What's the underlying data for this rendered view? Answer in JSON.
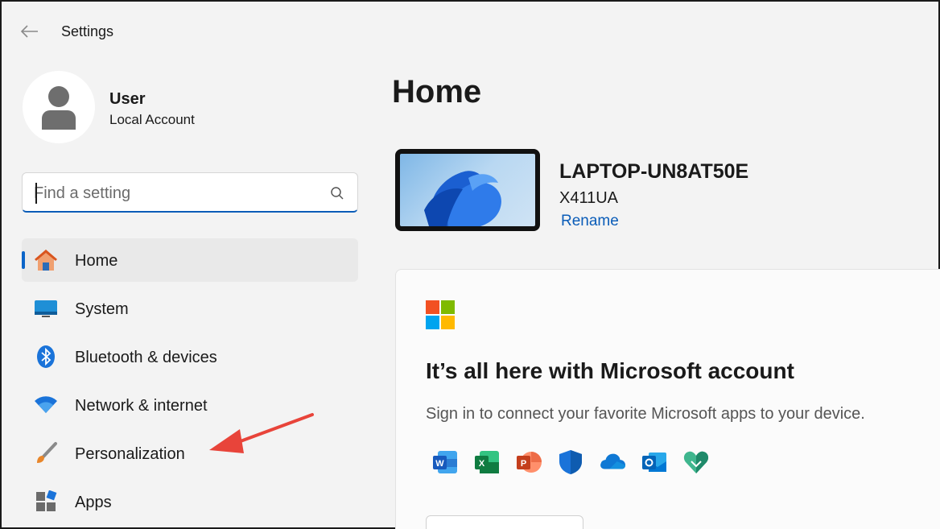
{
  "window": {
    "title": "Settings"
  },
  "profile": {
    "name": "User",
    "account_type": "Local Account"
  },
  "search": {
    "placeholder": "Find a setting",
    "value": ""
  },
  "sidebar": {
    "items": [
      {
        "label": "Home",
        "icon": "home-icon",
        "active": true
      },
      {
        "label": "System",
        "icon": "system-icon"
      },
      {
        "label": "Bluetooth & devices",
        "icon": "bluetooth-icon"
      },
      {
        "label": "Network & internet",
        "icon": "wifi-icon"
      },
      {
        "label": "Personalization",
        "icon": "paintbrush-icon"
      },
      {
        "label": "Apps",
        "icon": "apps-icon"
      }
    ]
  },
  "main": {
    "title": "Home",
    "device": {
      "name": "LAPTOP-UN8AT50E",
      "model": "X411UA",
      "rename_label": "Rename"
    },
    "promo": {
      "title": "It’s all here with Microsoft account",
      "description": "Sign in to connect your favorite Microsoft apps to your device.",
      "apps": [
        "word-icon",
        "excel-icon",
        "powerpoint-icon",
        "defender-icon",
        "onedrive-icon",
        "outlook-icon",
        "family-safety-icon"
      ]
    }
  },
  "colors": {
    "accent": "#0a5cb8",
    "annotation_arrow": "#e8443a"
  }
}
